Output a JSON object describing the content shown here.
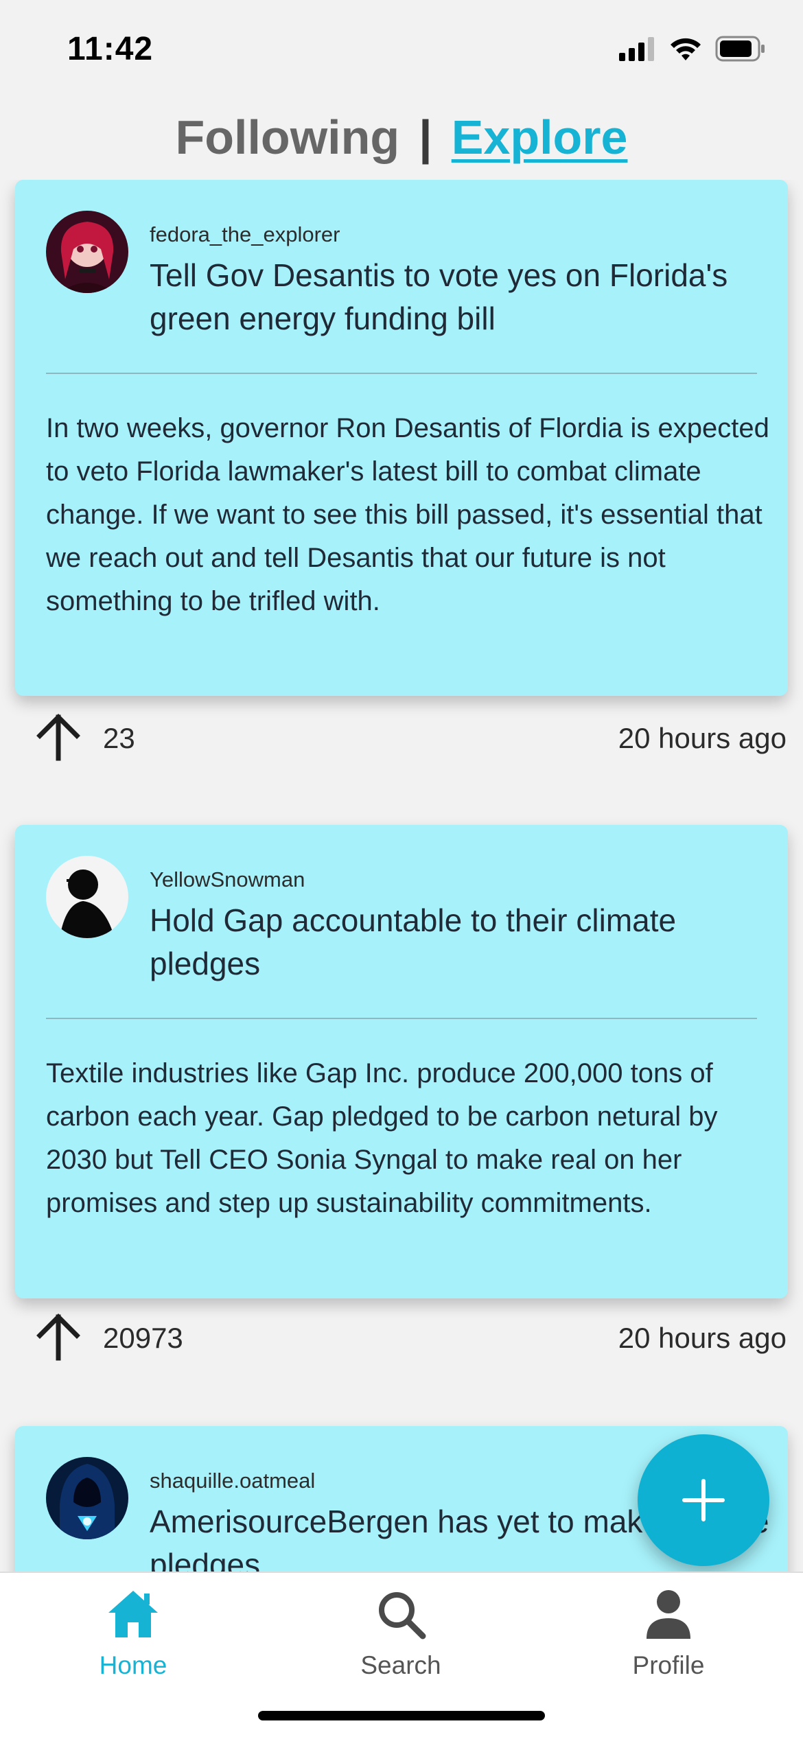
{
  "status_bar": {
    "time": "11:42"
  },
  "header": {
    "tab_following": "Following",
    "separator": "|",
    "tab_explore": "Explore"
  },
  "posts": [
    {
      "username": "fedora_the_explorer",
      "title": "Tell Gov Desantis to vote yes on Florida's green energy funding bill",
      "body": "In two weeks, governor Ron Desantis of Flordia is expected to veto Florida lawmaker's latest bill to combat climate change. If we want to see this bill passed, it's essential that we reach out and tell Desantis that our future is not something to be trifled with.",
      "votes": "23",
      "time": "20 hours ago",
      "avatar": "anime-girl-red-hair-avatar"
    },
    {
      "username": "YellowSnowman",
      "title": "Hold Gap accountable to their climate pledges",
      "body": "Textile industries like Gap Inc. produce 200,000 tons of carbon each year. Gap pledged to be carbon netural by 2030 but Tell CEO Sonia Syngal to make real on her promises and step up sustainability commitments.",
      "votes": "20973",
      "time": "20 hours ago",
      "avatar": "silhouette-avatar"
    },
    {
      "username": "shaquille.oatmeal",
      "title": "AmerisourceBergen has yet to make climate pledges",
      "avatar": "hooded-figure-blue-avatar"
    }
  ],
  "fab": {
    "icon": "plus-icon"
  },
  "bottom_nav": {
    "home": "Home",
    "search": "Search",
    "profile": "Profile"
  },
  "colors": {
    "accent": "#16b3d4",
    "card": "#a7f1fa",
    "background": "#f2f2f2"
  }
}
